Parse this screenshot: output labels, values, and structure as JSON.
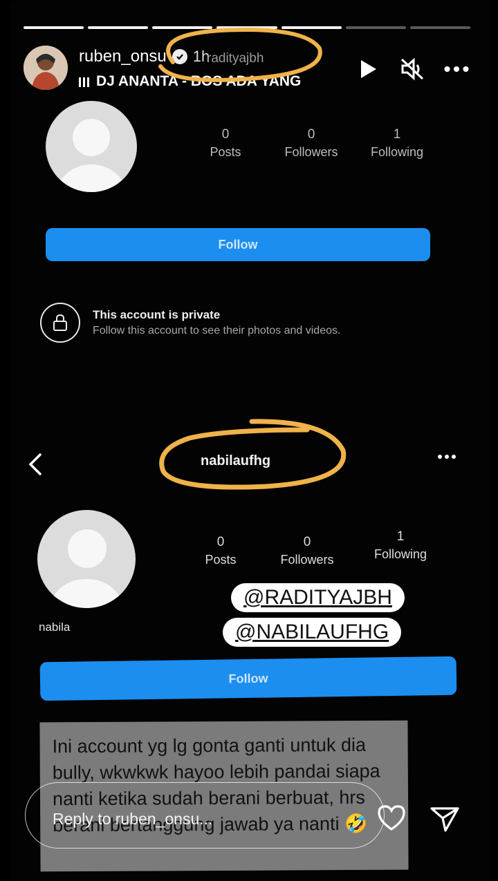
{
  "story": {
    "segments_total": 7,
    "segments_done": 5,
    "username": "ruben_onsu",
    "time": "1h",
    "overlay_tag": "radityajbh",
    "music": "DJ ANANTA - BOS ADA YANG",
    "icons": [
      "play-icon",
      "mute-icon",
      "more-icon"
    ]
  },
  "profile1": {
    "posts_count": "0",
    "posts_label": "Posts",
    "followers_count": "0",
    "followers_label": "Followers",
    "following_count": "1",
    "following_label": "Following",
    "follow_label": "Follow",
    "private_title": "This account is private",
    "private_sub": "Follow this account to see their photos and videos."
  },
  "profile2": {
    "username": "nabilaufhg",
    "display_name": "nabila",
    "posts_count": "0",
    "posts_label": "Posts",
    "followers_count": "0",
    "followers_label": "Followers",
    "following_count": "1",
    "following_label": "Following",
    "follow_label": "Follow"
  },
  "stickers": {
    "line1": "@RADITYAJBH",
    "line2": "@NABILAUFHG"
  },
  "caption": {
    "text": "Ini account yg lg gonta ganti untuk dia bully, wkwkwk hayoo lebih pandai siapa nanti ketika sudah berani berbuat, hrs berani bertanggung jawab ya nanti 🤣"
  },
  "reply": {
    "placeholder": "Reply to ruben_onsu..."
  },
  "colors": {
    "follow_button": "#1c8ef0",
    "highlight_circle": "#f0b24a",
    "background": "#030303"
  }
}
